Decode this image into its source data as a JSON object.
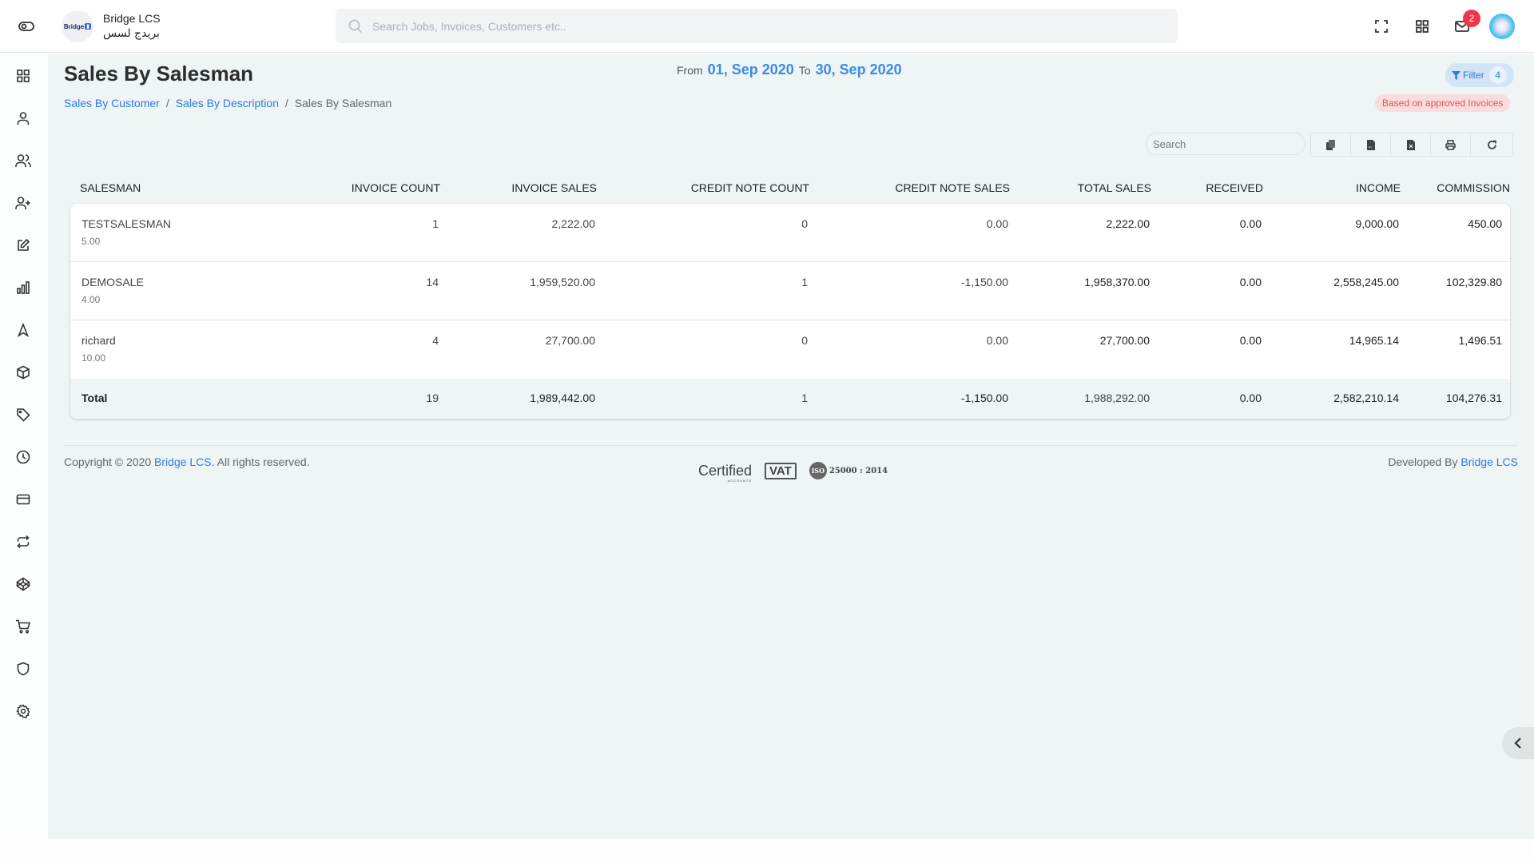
{
  "header": {
    "brand_name": "Bridge LCS",
    "brand_arabic": "بريدج لسس",
    "brand_logo_text": "Bridge",
    "search_placeholder": "Search Jobs, Invoices, Customers etc..",
    "notification_count": "2",
    "icons": [
      "sidebar-toggle-icon",
      "search-icon",
      "fullscreen-icon",
      "apps-grid-icon",
      "mail-icon",
      "user-avatar"
    ]
  },
  "sidebar": {
    "items": [
      {
        "icon": "dashboard-grid-icon"
      },
      {
        "icon": "user-icon"
      },
      {
        "icon": "users-icon"
      },
      {
        "icon": "user-plus-icon"
      },
      {
        "icon": "edit-icon"
      },
      {
        "icon": "bar-chart-icon"
      },
      {
        "icon": "navigation-icon"
      },
      {
        "icon": "box-icon"
      },
      {
        "icon": "tag-icon"
      },
      {
        "icon": "clock-icon"
      },
      {
        "icon": "credit-card-icon"
      },
      {
        "icon": "repeat-icon"
      },
      {
        "icon": "codepen-icon"
      },
      {
        "icon": "shopping-cart-icon"
      },
      {
        "icon": "shield-icon"
      },
      {
        "icon": "settings-icon"
      }
    ]
  },
  "page": {
    "title": "Sales By Salesman",
    "breadcrumb": [
      {
        "label": "Sales By Customer"
      },
      {
        "label": "Sales By Description"
      },
      {
        "label": "Sales By Salesman"
      }
    ],
    "breadcrumb_sep": "/",
    "date_from_label": "From",
    "date_from": "01, Sep 2020",
    "date_to_label": "To",
    "date_to": "30, Sep 2020",
    "filter_label": "Filter",
    "filter_count": "4",
    "approved_note": "Based on approved Invoices",
    "colors": {
      "accent": "#2c7be5",
      "date": "#3a8bea",
      "danger": "#e55353",
      "badge": "#f0344a"
    }
  },
  "table_tools": {
    "search_placeholder": "Search",
    "buttons": [
      "copy",
      "csv",
      "excel",
      "print",
      "refresh"
    ]
  },
  "table": {
    "columns": [
      "SALESMAN",
      "INVOICE COUNT",
      "INVOICE SALES",
      "CREDIT NOTE COUNT",
      "CREDIT NOTE SALES",
      "TOTAL SALES",
      "RECEIVED",
      "INCOME",
      "COMMISSION"
    ],
    "rows": [
      {
        "salesman": "TESTSALESMAN",
        "rate": "5.00",
        "invoice_count": "1",
        "invoice_sales": "2,222.00",
        "credit_note_count": "0",
        "credit_note_sales": "0.00",
        "total_sales": "2,222.00",
        "received": "0.00",
        "income": "9,000.00",
        "commission": "450.00"
      },
      {
        "salesman": "DEMOSALE",
        "rate": "4.00",
        "invoice_count": "14",
        "invoice_sales": "1,959,520.00",
        "credit_note_count": "1",
        "credit_note_sales": "-1,150.00",
        "total_sales": "1,958,370.00",
        "received": "0.00",
        "income": "2,558,245.00",
        "commission": "102,329.80"
      },
      {
        "salesman": "richard",
        "rate": "10.00",
        "invoice_count": "4",
        "invoice_sales": "27,700.00",
        "credit_note_count": "0",
        "credit_note_sales": "0.00",
        "total_sales": "27,700.00",
        "received": "0.00",
        "income": "14,965.14",
        "commission": "1,496.51"
      }
    ],
    "total": {
      "label": "Total",
      "invoice_count": "19",
      "invoice_sales": "1,989,442.00",
      "credit_note_count": "1",
      "credit_note_sales": "-1,150.00",
      "total_sales": "1,988,292.00",
      "received": "0.00",
      "income": "2,582,210.14",
      "commission": "104,276.31"
    }
  },
  "footer": {
    "copyright_prefix": "Copyright © 2020",
    "copyright_link": "Bridge LCS",
    "copyright_suffix": ". All rights reserved.",
    "developed_by": "Developed By",
    "developer_link": "Bridge LCS",
    "cert_certified": "Certified",
    "cert_certified_sub": "ACCOUNTS",
    "cert_vat": "VAT",
    "cert_iso_logo": "ISO",
    "cert_iso_text": "25000 : 2014"
  }
}
